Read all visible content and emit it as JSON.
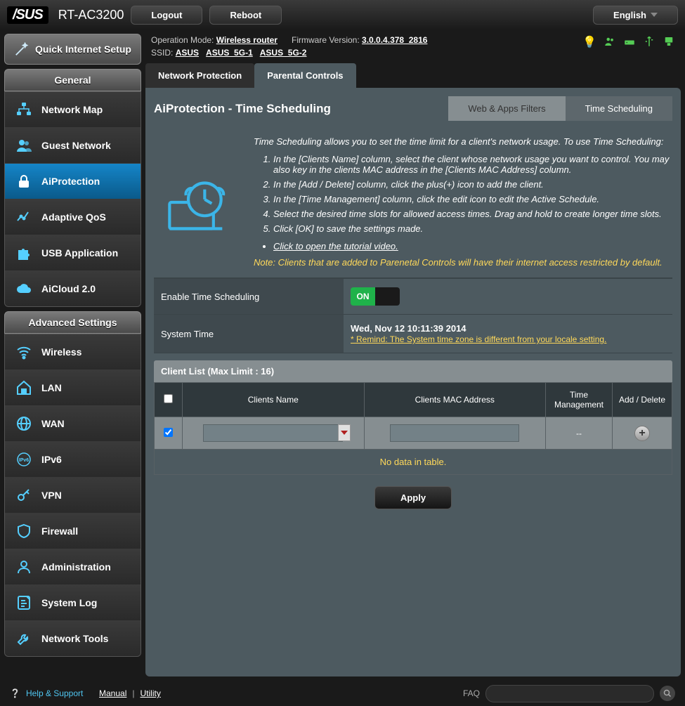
{
  "header": {
    "brand": "/SUS",
    "model": "RT-AC3200",
    "logout": "Logout",
    "reboot": "Reboot",
    "language": "English"
  },
  "status": {
    "op_mode_label": "Operation Mode: ",
    "op_mode": "Wireless router",
    "fw_label": "Firmware Version: ",
    "fw": "3.0.0.4.378_2816",
    "ssid_label": "SSID: ",
    "ssid1": "ASUS",
    "ssid2": "ASUS_5G-1",
    "ssid3": "ASUS_5G-2"
  },
  "sidebar": {
    "qis": "Quick Internet Setup",
    "general_head": "General",
    "general": [
      {
        "label": "Network Map"
      },
      {
        "label": "Guest Network"
      },
      {
        "label": "AiProtection"
      },
      {
        "label": "Adaptive QoS"
      },
      {
        "label": "USB Application"
      },
      {
        "label": "AiCloud 2.0"
      }
    ],
    "advanced_head": "Advanced Settings",
    "advanced": [
      {
        "label": "Wireless"
      },
      {
        "label": "LAN"
      },
      {
        "label": "WAN"
      },
      {
        "label": "IPv6"
      },
      {
        "label": "VPN"
      },
      {
        "label": "Firewall"
      },
      {
        "label": "Administration"
      },
      {
        "label": "System Log"
      },
      {
        "label": "Network Tools"
      }
    ]
  },
  "tabs": {
    "a": "Network Protection",
    "b": "Parental Controls"
  },
  "panel": {
    "title": "AiProtection - Time Scheduling",
    "subtab_a": "Web & Apps Filters",
    "subtab_b": "Time Scheduling",
    "intro": "Time Scheduling allows you to set the time limit for a client's network usage. To use Time Scheduling:",
    "steps": [
      "In the [Clients Name] column, select the client whose network usage you want to control. You may also key in the clients MAC address in the [Clients MAC Address] column.",
      "In the [Add / Delete] column, click the plus(+) icon to add the client.",
      "In the [Time Management] column, click the edit icon to edit the Active Schedule.",
      "Select the desired time slots for allowed access times. Drag and hold to create longer time slots.",
      "Click [OK] to save the settings made."
    ],
    "tutorial": "Click to open the tutorial video.",
    "note": "Note: Clients that are added to Parenetal Controls will have their internet access restricted by default.",
    "enable_label": "Enable Time Scheduling",
    "toggle_on": "ON",
    "systime_label": "System Time",
    "systime": "Wed, Nov 12 10:11:39 2014",
    "remind": "* Remind: The System time zone is different from your locale setting.",
    "client_list_hdr": "Client List (Max Limit : 16)",
    "cols": {
      "name": "Clients Name",
      "mac": "Clients MAC Address",
      "tm": "Time Management",
      "ad": "Add / Delete"
    },
    "no_data": "No data in table.",
    "tm_placeholder": "--",
    "apply": "Apply"
  },
  "footer": {
    "help": "Help & Support",
    "manual": "Manual",
    "sep": " | ",
    "utility": "Utility",
    "faq": "FAQ"
  }
}
